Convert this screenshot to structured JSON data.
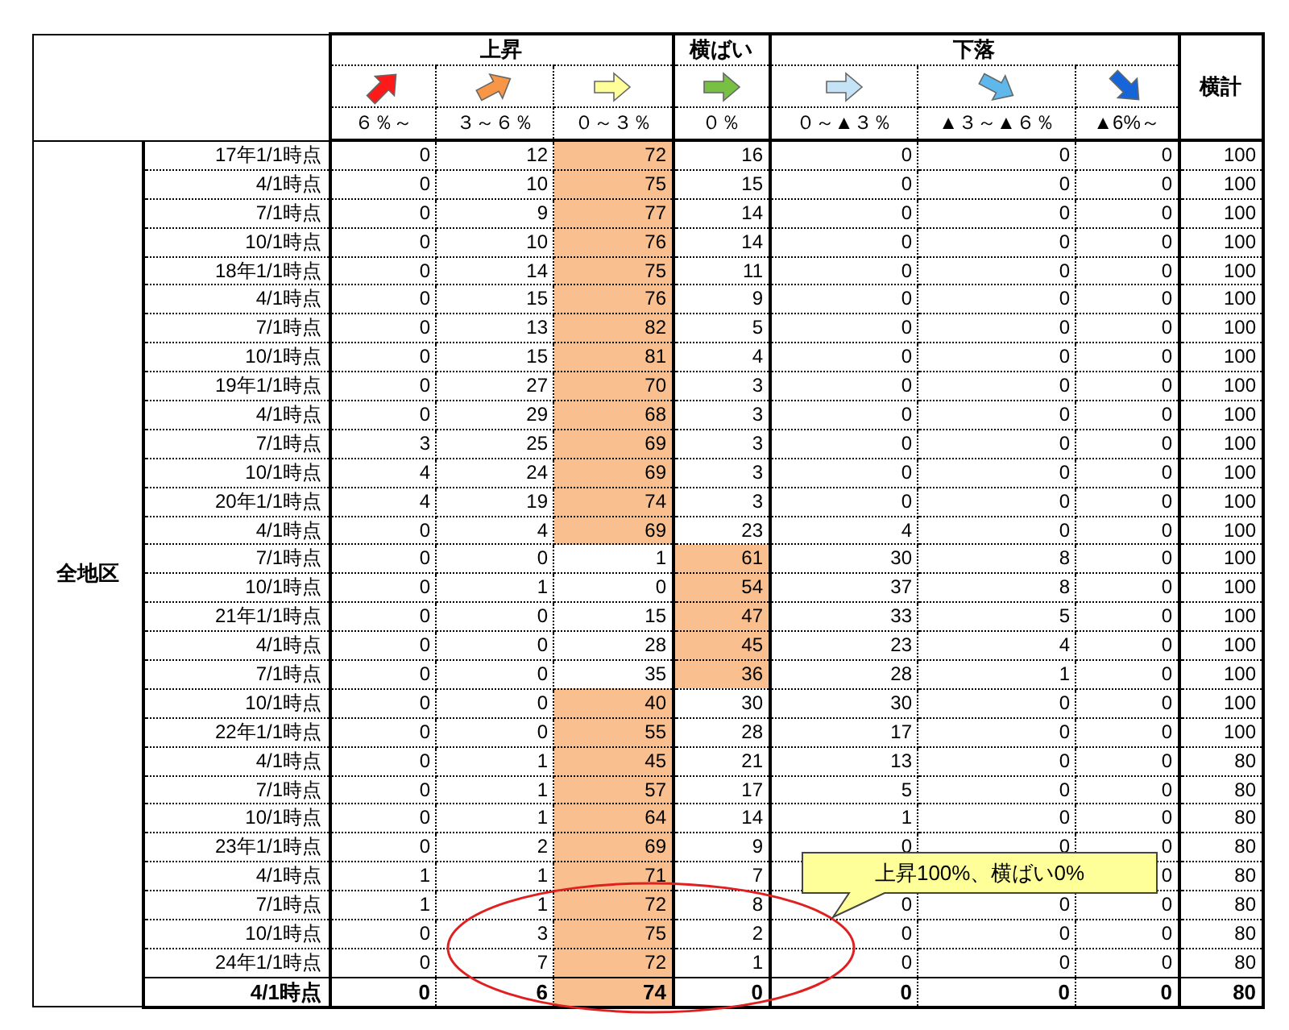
{
  "corner_label": "全地区",
  "total_label": "横計",
  "groups": [
    {
      "label": "上昇",
      "columns": [
        {
          "kind": "up",
          "color": "#ff1a1a",
          "range": "６％～"
        },
        {
          "kind": "up_slight",
          "color": "#f79646",
          "range": "３～６％"
        },
        {
          "kind": "right",
          "color": "#ffff99",
          "range": "０～３％"
        }
      ]
    },
    {
      "label": "横ばい",
      "columns": [
        {
          "kind": "right",
          "color": "#77c043",
          "range": "０％"
        }
      ]
    },
    {
      "label": "下落",
      "columns": [
        {
          "kind": "right",
          "color": "#c5e3f6",
          "range": "０～▲３％"
        },
        {
          "kind": "down_slight",
          "color": "#5fb8ec",
          "range": "▲３～▲６％"
        },
        {
          "kind": "down",
          "color": "#1565d8",
          "range": "▲6%～"
        }
      ]
    }
  ],
  "rows": [
    {
      "date": "17年1/1時点",
      "values": [
        "0",
        "12",
        "72",
        "16",
        "0",
        "0",
        "0"
      ],
      "total": "100",
      "flat_highlighted": false,
      "covered": false,
      "bold": false
    },
    {
      "date": "4/1時点",
      "values": [
        "0",
        "10",
        "75",
        "15",
        "0",
        "0",
        "0"
      ],
      "total": "100",
      "flat_highlighted": false,
      "covered": false,
      "bold": false
    },
    {
      "date": "7/1時点",
      "values": [
        "0",
        "9",
        "77",
        "14",
        "0",
        "0",
        "0"
      ],
      "total": "100",
      "flat_highlighted": false,
      "covered": false,
      "bold": false
    },
    {
      "date": "10/1時点",
      "values": [
        "0",
        "10",
        "76",
        "14",
        "0",
        "0",
        "0"
      ],
      "total": "100",
      "flat_highlighted": false,
      "covered": false,
      "bold": false
    },
    {
      "date": "18年1/1時点",
      "values": [
        "0",
        "14",
        "75",
        "11",
        "0",
        "0",
        "0"
      ],
      "total": "100",
      "flat_highlighted": false,
      "covered": false,
      "bold": false
    },
    {
      "date": "4/1時点",
      "values": [
        "0",
        "15",
        "76",
        "9",
        "0",
        "0",
        "0"
      ],
      "total": "100",
      "flat_highlighted": false,
      "covered": false,
      "bold": false
    },
    {
      "date": "7/1時点",
      "values": [
        "0",
        "13",
        "82",
        "5",
        "0",
        "0",
        "0"
      ],
      "total": "100",
      "flat_highlighted": false,
      "covered": false,
      "bold": false
    },
    {
      "date": "10/1時点",
      "values": [
        "0",
        "15",
        "81",
        "4",
        "0",
        "0",
        "0"
      ],
      "total": "100",
      "flat_highlighted": false,
      "covered": false,
      "bold": false
    },
    {
      "date": "19年1/1時点",
      "values": [
        "0",
        "27",
        "70",
        "3",
        "0",
        "0",
        "0"
      ],
      "total": "100",
      "flat_highlighted": false,
      "covered": false,
      "bold": false
    },
    {
      "date": "4/1時点",
      "values": [
        "0",
        "29",
        "68",
        "3",
        "0",
        "0",
        "0"
      ],
      "total": "100",
      "flat_highlighted": false,
      "covered": false,
      "bold": false
    },
    {
      "date": "7/1時点",
      "values": [
        "3",
        "25",
        "69",
        "3",
        "0",
        "0",
        "0"
      ],
      "total": "100",
      "flat_highlighted": false,
      "covered": false,
      "bold": false
    },
    {
      "date": "10/1時点",
      "values": [
        "4",
        "24",
        "69",
        "3",
        "0",
        "0",
        "0"
      ],
      "total": "100",
      "flat_highlighted": false,
      "covered": false,
      "bold": false
    },
    {
      "date": "20年1/1時点",
      "values": [
        "4",
        "19",
        "74",
        "3",
        "0",
        "0",
        "0"
      ],
      "total": "100",
      "flat_highlighted": false,
      "covered": false,
      "bold": false
    },
    {
      "date": "4/1時点",
      "values": [
        "0",
        "4",
        "69",
        "23",
        "4",
        "0",
        "0"
      ],
      "total": "100",
      "flat_highlighted": false,
      "covered": false,
      "bold": false
    },
    {
      "date": "7/1時点",
      "values": [
        "0",
        "0",
        "1",
        "61",
        "30",
        "8",
        "0"
      ],
      "total": "100",
      "flat_highlighted": true,
      "covered": false,
      "bold": false
    },
    {
      "date": "10/1時点",
      "values": [
        "0",
        "1",
        "0",
        "54",
        "37",
        "8",
        "0"
      ],
      "total": "100",
      "flat_highlighted": true,
      "covered": false,
      "bold": false
    },
    {
      "date": "21年1/1時点",
      "values": [
        "0",
        "0",
        "15",
        "47",
        "33",
        "5",
        "0"
      ],
      "total": "100",
      "flat_highlighted": true,
      "covered": false,
      "bold": false
    },
    {
      "date": "4/1時点",
      "values": [
        "0",
        "0",
        "28",
        "45",
        "23",
        "4",
        "0"
      ],
      "total": "100",
      "flat_highlighted": true,
      "covered": false,
      "bold": false
    },
    {
      "date": "7/1時点",
      "values": [
        "0",
        "0",
        "35",
        "36",
        "28",
        "1",
        "0"
      ],
      "total": "100",
      "flat_highlighted": true,
      "covered": false,
      "bold": false
    },
    {
      "date": "10/1時点",
      "values": [
        "0",
        "0",
        "40",
        "30",
        "30",
        "0",
        "0"
      ],
      "total": "100",
      "flat_highlighted": false,
      "covered": false,
      "bold": false
    },
    {
      "date": "22年1/1時点",
      "values": [
        "0",
        "0",
        "55",
        "28",
        "17",
        "0",
        "0"
      ],
      "total": "100",
      "flat_highlighted": false,
      "covered": false,
      "bold": false
    },
    {
      "date": "4/1時点",
      "values": [
        "0",
        "1",
        "45",
        "21",
        "13",
        "0",
        "0"
      ],
      "total": "80",
      "flat_highlighted": false,
      "covered": false,
      "bold": false
    },
    {
      "date": "7/1時点",
      "values": [
        "0",
        "1",
        "57",
        "17",
        "5",
        "0",
        "0"
      ],
      "total": "80",
      "flat_highlighted": false,
      "covered": false,
      "bold": false
    },
    {
      "date": "10/1時点",
      "values": [
        "0",
        "1",
        "64",
        "14",
        "1",
        "0",
        "0"
      ],
      "total": "80",
      "flat_highlighted": false,
      "covered": false,
      "bold": false
    },
    {
      "date": "23年1/1時点",
      "values": [
        "0",
        "2",
        "69",
        "9",
        "0",
        "0",
        "0"
      ],
      "total": "80",
      "flat_highlighted": false,
      "covered": false,
      "bold": false
    },
    {
      "date": "4/1時点",
      "values": [
        "1",
        "1",
        "71",
        "7",
        "0"
      ],
      "total": "80",
      "flat_highlighted": false,
      "covered": true,
      "bold": false
    },
    {
      "date": "7/1時点",
      "values": [
        "1",
        "1",
        "72",
        "8",
        "0",
        "0",
        "0"
      ],
      "total": "80",
      "flat_highlighted": false,
      "covered": false,
      "bold": false
    },
    {
      "date": "10/1時点",
      "values": [
        "0",
        "3",
        "75",
        "2",
        "0",
        "0",
        "0"
      ],
      "total": "80",
      "flat_highlighted": false,
      "covered": false,
      "bold": false
    },
    {
      "date": "24年1/1時点",
      "values": [
        "0",
        "7",
        "72",
        "1",
        "0",
        "0",
        "0"
      ],
      "total": "80",
      "flat_highlighted": false,
      "covered": false,
      "bold": false
    },
    {
      "date": "4/1時点",
      "values": [
        "0",
        "6",
        "74",
        "0",
        "0",
        "0",
        "0"
      ],
      "total": "80",
      "flat_highlighted": false,
      "covered": false,
      "bold": true
    }
  ],
  "callout": {
    "text": "上昇100%、横ばい0%"
  }
}
